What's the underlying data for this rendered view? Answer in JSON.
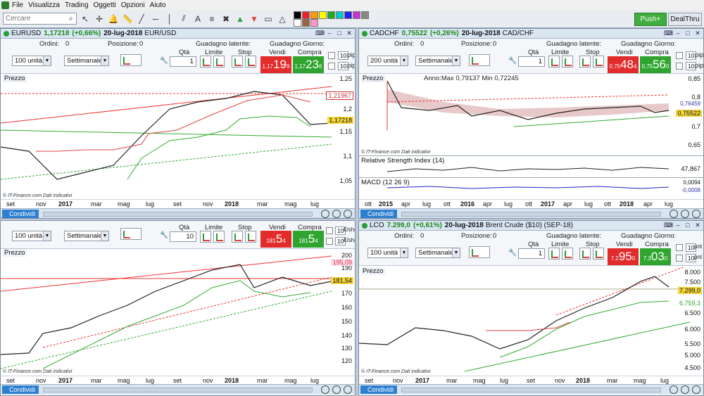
{
  "menu": [
    "File",
    "Visualizza",
    "Trading",
    "Oggetti",
    "Opzioni",
    "Aiuto"
  ],
  "search": {
    "placeholder": "Cercare"
  },
  "toolbar": {
    "push_label": "Push+",
    "dealthru_label": "DealThru"
  },
  "colors": {
    "sell": "#e22b2b",
    "buy": "#2fa52f",
    "panel_title": "#dbe6f3",
    "up": "#2a9d3c",
    "down": "#d44"
  },
  "labels": {
    "ordini": "Ordini:",
    "posizione": "Posizione:",
    "guadagno_latente": "Guadagno latente:",
    "guadagno_giorno": "Guadagno Giorno:",
    "qta": "Qtà",
    "limite": "Limite",
    "stop": "Stop",
    "vendi": "Vendi",
    "compra": "Compra",
    "prezzo": "Prezzo",
    "condividi": "Condividi",
    "source": "© IT-Finance.com Dati indicativi",
    "settimanale": "Settimanale"
  },
  "panels": [
    {
      "symbol": "EURUSD",
      "price": "1,17218",
      "change": "(+0,66%)",
      "date": "20-lug-2018",
      "name": "EUR/USD",
      "ordini": "0",
      "posizione": "0",
      "qty_select": "100 unità",
      "qty": "1",
      "sell": {
        "big": "1,17",
        "mid": "19",
        "sup": "9"
      },
      "buy": {
        "big": "1,17",
        "mid": "23",
        "sup": "6"
      },
      "pip": "10",
      "pip_unit": "pip",
      "y_ticks": [
        "1,25",
        "1,2",
        "1,15",
        "1,1",
        "1,05"
      ],
      "tags": [
        "1,21967",
        "1,17218"
      ],
      "x_ticks": [
        "set",
        "nov",
        "2017",
        "mar",
        "mag",
        "lug",
        "set",
        "nov",
        "2018",
        "mar",
        "mag",
        "lug"
      ]
    },
    {
      "symbol": "CADCHF",
      "price": "0,75522",
      "change": "(+0,26%)",
      "date": "20-lug-2018",
      "name": "CAD/CHF",
      "ordini": "0",
      "posizione": "0",
      "qty_select": "200 unità",
      "qty": "1",
      "sell": {
        "big": "0,75",
        "mid": "48",
        "sup": "4"
      },
      "buy": {
        "big": "0,75",
        "mid": "56",
        "sup": "0"
      },
      "pip": "10",
      "pip_unit": "pip",
      "annotation": "Anno:Max 0,79137 Min 0,72245",
      "y_ticks": [
        "0,85",
        "0,8",
        "0,7",
        "0,65"
      ],
      "tags": [
        "0,76459",
        "0,75522"
      ],
      "rsi_label": "Relative Strength Index (14)",
      "rsi_value": "47,867",
      "macd_label": "MACD (12 26 9)",
      "macd_values": [
        "0,0094",
        "-0,0008"
      ],
      "x_ticks": [
        "ott",
        "2015",
        "apr",
        "lug",
        "ott",
        "2016",
        "apr",
        "lug",
        "ott",
        "2017",
        "apr",
        "lug",
        "ott",
        "2018",
        "apr",
        "lug"
      ]
    },
    {
      "symbol": "",
      "price": "",
      "change": "",
      "date": "",
      "name": "",
      "qty_select": "100 unità",
      "qty": "10",
      "sell": {
        "big": "181",
        "mid": "5",
        "sup": "4"
      },
      "buy": {
        "big": "181",
        "mid": "5",
        "sup": "4"
      },
      "pip": "10",
      "pip_unit": "€/shr",
      "y_ticks": [
        "200",
        "190",
        "170",
        "160",
        "150",
        "140",
        "130",
        "120"
      ],
      "tags": [
        "195,09",
        "181,54"
      ],
      "x_ticks": [
        "set",
        "nov",
        "2017",
        "mar",
        "mag",
        "lug",
        "set",
        "nov",
        "2018",
        "mar",
        "mag",
        "lug"
      ]
    },
    {
      "symbol": "LCO",
      "price": "7.299,0",
      "change": "(+0,61%)",
      "date": "20-lug-2018",
      "name": "Brent Crude ($10) (SEP-18)",
      "ordini": "0",
      "posizione": "0",
      "qty_select": "100 unità",
      "qty": "1",
      "sell": {
        "big": "7.2",
        "mid": "95",
        "sup": "0"
      },
      "buy": {
        "big": "7.3",
        "mid": "03",
        "sup": "0"
      },
      "pip": "10",
      "pip_unit": "pnt",
      "y_ticks": [
        "8.000",
        "7.500",
        "6.500",
        "6.000",
        "5.500",
        "5.000",
        "4.500"
      ],
      "tags": [
        "7.299,0",
        "6.759,3"
      ],
      "x_ticks": [
        "set",
        "nov",
        "2017",
        "mar",
        "mag",
        "lug",
        "set",
        "nov",
        "2018",
        "mar",
        "mag",
        "lug"
      ]
    }
  ]
}
